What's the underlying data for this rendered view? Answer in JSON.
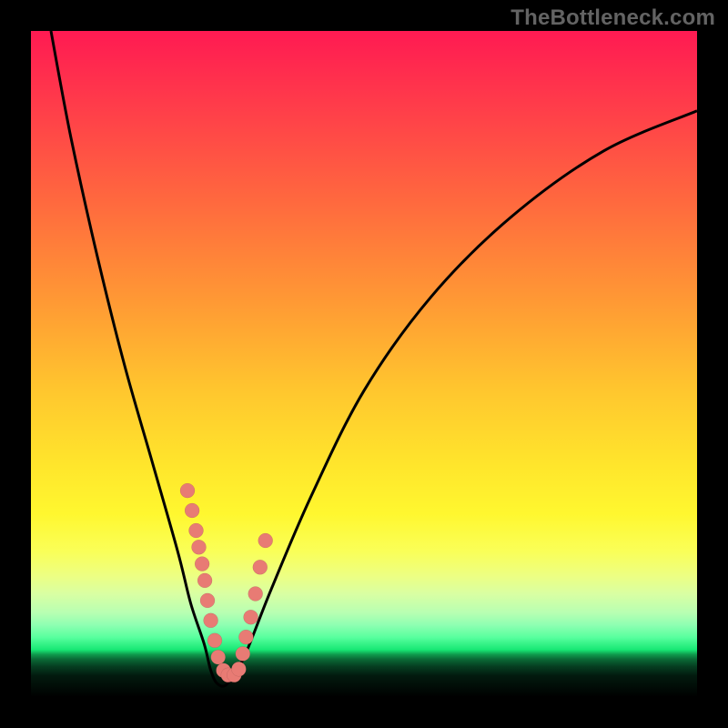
{
  "watermark": "TheBottleneck.com",
  "colors": {
    "frame": "#000000",
    "curve": "#000000",
    "dot": "#e87b74",
    "gradient_top": "#ff1a52",
    "gradient_mid": "#ffe52c",
    "gradient_bottom": "#18e874"
  },
  "chart_data": {
    "type": "line",
    "title": "",
    "xlabel": "",
    "ylabel": "",
    "xlim": [
      0,
      100
    ],
    "ylim": [
      0,
      100
    ],
    "series": [
      {
        "name": "bottleneck-curve",
        "x": [
          3,
          6,
          10,
          14,
          18,
          22,
          24,
          26,
          27,
          28,
          29.5,
          32,
          36,
          42,
          50,
          60,
          72,
          86,
          100
        ],
        "y": [
          100,
          84,
          66,
          50,
          36,
          22,
          14,
          8,
          4,
          2,
          2,
          6,
          16,
          30,
          46,
          60,
          72,
          82,
          88
        ]
      }
    ],
    "dots": {
      "name": "highlighted-points",
      "x": [
        23.5,
        24.2,
        24.8,
        25.2,
        25.7,
        26.1,
        26.5,
        27.0,
        27.6,
        28.1,
        28.9,
        29.6,
        30.5,
        31.2,
        31.8,
        32.3,
        33.0,
        33.7,
        34.4,
        35.2
      ],
      "y": [
        31.0,
        28.0,
        25.0,
        22.5,
        20.0,
        17.5,
        14.5,
        11.5,
        8.5,
        6.0,
        4.0,
        3.3,
        3.3,
        4.2,
        6.5,
        9.0,
        12.0,
        15.5,
        19.5,
        23.5
      ]
    }
  }
}
